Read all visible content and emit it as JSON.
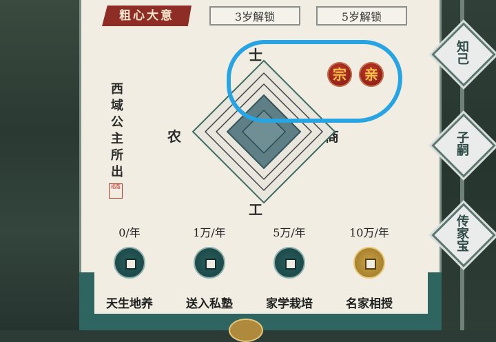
{
  "header": {
    "tag": "粗心大意",
    "lock_left": "3岁解锁",
    "lock_right": "5岁解锁"
  },
  "origin_text": "西域公主所出",
  "seal_small": "福蔭",
  "seals": [
    "宗",
    "亲"
  ],
  "axes": {
    "top": "士",
    "left": "农",
    "right": "商",
    "bottom": "工"
  },
  "coins": [
    {
      "price": "0/年",
      "name": "天生地养",
      "style": "teal"
    },
    {
      "price": "1万/年",
      "name": "送入私塾",
      "style": "teal"
    },
    {
      "price": "5万/年",
      "name": "家学栽培",
      "style": "teal"
    },
    {
      "price": "10万/年",
      "name": "名家相授",
      "style": "gold"
    }
  ],
  "side_tabs": [
    "知己",
    "子嗣",
    "传家宝"
  ],
  "colors": {
    "accent_red": "#8e2d26",
    "teal": "#2f6560",
    "highlight": "#29a4e3",
    "gold": "#c9a24a"
  }
}
